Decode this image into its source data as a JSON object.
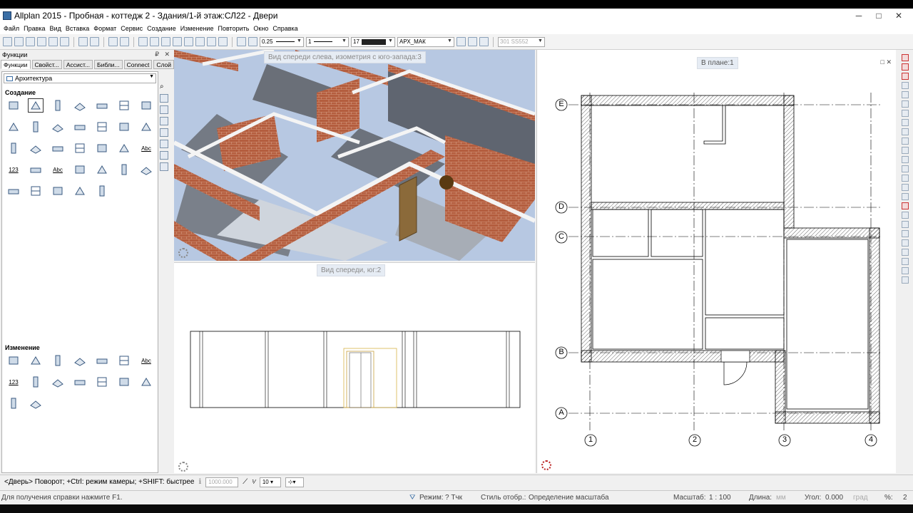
{
  "window": {
    "title": "Allplan 2015 - Пробная - коттедж 2 - Здания/1-й этаж:СЛ22 - Двери",
    "controls": [
      "minimize-icon",
      "maximize-icon",
      "close-icon"
    ]
  },
  "menu": [
    "Файл",
    "Правка",
    "Вид",
    "Вставка",
    "Формат",
    "Сервис",
    "Создание",
    "Изменение",
    "Повторить",
    "Окно",
    "Справка"
  ],
  "toolbar": {
    "pen_value": "0.25",
    "line_value": "1",
    "color_value": "17",
    "layer_value": "АРХ_МАК",
    "scale_value": "301 SS552"
  },
  "panel": {
    "title": "Функции",
    "tabs": [
      "Функции",
      "Свойст...",
      "Ассист...",
      "Библи...",
      "Connect",
      "Слой"
    ],
    "category": "Архитектура",
    "section_create": "Создание",
    "section_modify": "Изменение",
    "create_tools": [
      "wall-tool-icon",
      "opening-tool-icon",
      "stair-tool-icon",
      "column-tool-icon",
      "pillar-tool-icon",
      "slab-tool-icon",
      "roof-tool-icon",
      "beam-tool-icon",
      "window-tool-icon",
      "door-tool-icon",
      "niche-tool-icon",
      "chimney-tool-icon",
      "box-tool-icon",
      "panel-tool-icon",
      "ramp-tool-icon",
      "floor-tool-icon",
      "railing-tool-icon",
      "surface-tool-icon",
      "hatch-tool-icon",
      "level-tool-icon",
      "text-tool-icon",
      "label-number-icon",
      "grid-tool-icon",
      "label-abc-icon",
      "list-tool-icon",
      "report-tool-icon",
      "room-tool-icon",
      "section-tool-icon",
      "slope-tool-icon",
      "recess-tool-icon",
      "arch-tool-icon",
      "module-tool-icon",
      "facade-tool-icon"
    ],
    "create_text_labels": {
      "text_tool": "Abc",
      "label_number": "123",
      "label_abc": "Abc"
    },
    "modify_tools": [
      "modify-wall-icon",
      "modify-layer-icon",
      "modify-height-icon",
      "modify-length-icon",
      "modify-view-icon",
      "modify-pen-icon",
      "modify-text-icon",
      "modify-number-icon",
      "modify-opening-icon",
      "modify-join-icon",
      "modify-attr-icon",
      "modify-copy-icon",
      "modify-group-icon",
      "modify-round-icon",
      "modify-split-icon",
      "modify-arc-icon"
    ],
    "modify_text_labels": {
      "text": "Abc",
      "number": "123"
    }
  },
  "viewports": {
    "iso_label": "Вид спереди слева, изометрия с юго-запада:3",
    "front_label": "Вид спереди, юг:2",
    "plan_label": "В плане:1"
  },
  "plan": {
    "axis_rows": [
      "E",
      "D",
      "C",
      "B",
      "A"
    ],
    "axis_cols": [
      "1",
      "2",
      "3",
      "4"
    ]
  },
  "status": {
    "prompt": "<Дверь> Поворот; +Ctrl: режим камеры; +SHIFT: быстрее",
    "field_value": "1000.000",
    "step_value": "10",
    "help_text": "Для получения справки нажмите F1.",
    "mode_label": "Режим:",
    "mode_value": "? Тчк",
    "style_label": "Стиль отобр.:",
    "style_value": "Определение масштаба",
    "scale_label": "Масштаб:",
    "scale_value": "1 : 100",
    "length_label": "Длина:",
    "length_unit": "мм",
    "angle_label": "Угол:",
    "angle_value": "0.000",
    "angle_unit": "град",
    "percent_label": "%:",
    "percent_value": "2"
  }
}
